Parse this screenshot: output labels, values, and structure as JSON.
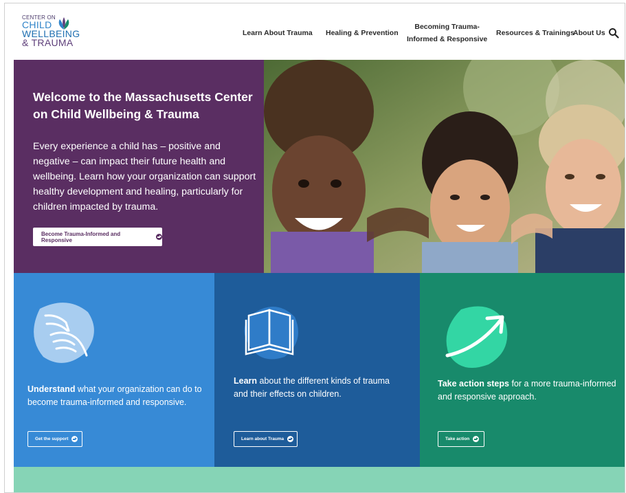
{
  "logo": {
    "top_text": "CENTER ON",
    "line1": "CHILD",
    "line2": "WELLBEING",
    "line3": "& TRAUMA"
  },
  "nav": {
    "items": [
      {
        "label": "Learn About Trauma"
      },
      {
        "label": "Healing & Prevention"
      },
      {
        "label": "Becoming Trauma-",
        "label2": "Informed & Responsive"
      },
      {
        "label": "Resources & Trainings"
      },
      {
        "label": "About Us"
      }
    ],
    "search_icon": "search-icon"
  },
  "hero": {
    "title": "Welcome to the Massachusetts Center on Child Wellbeing & Trauma",
    "text": "Every experience a child has – positive and negative – can impact their future health and wellbeing. Learn how your organization can support healthy development and healing, particularly for children impacted by trauma.",
    "button_label": "Become Trauma-Informed and Responsive"
  },
  "cards": [
    {
      "bold": "Understand",
      "text": " what your organization can do to become trauma-informed and responsive.",
      "button_label": "Get the support",
      "icon": "helping-hands-icon"
    },
    {
      "bold": "Learn",
      "text": " about the different kinds of trauma and their effects on children.",
      "button_label": "Learn about Trauma",
      "icon": "open-book-icon"
    },
    {
      "bold": "Take action steps",
      "text": " for a more trauma-informed and responsive approach.",
      "button_label": "Take action",
      "icon": "upward-arrow-icon"
    }
  ],
  "colors": {
    "purple": "#5a2e62",
    "blue_light": "#378ad6",
    "blue_dark": "#1e5c9a",
    "green": "#188a6b",
    "mint": "#86d4b6"
  }
}
